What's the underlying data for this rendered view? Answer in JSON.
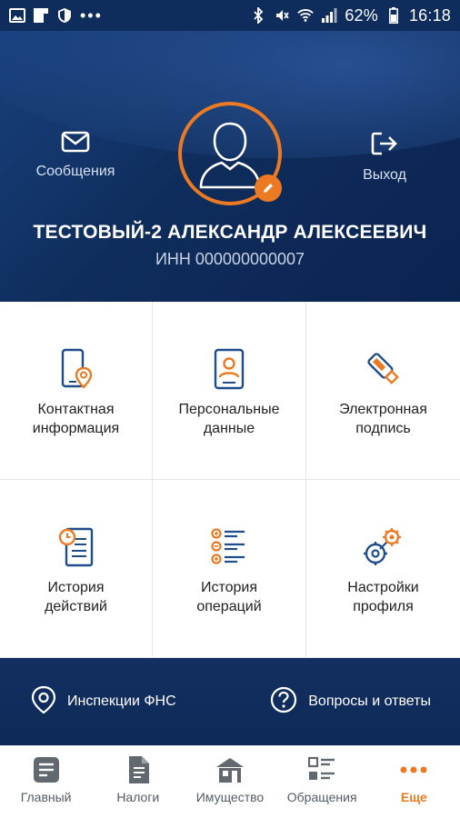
{
  "status_bar": {
    "battery": "62%",
    "time": "16:18",
    "overflow": "•••",
    "icons": [
      "image-icon",
      "flipboard-icon",
      "shield-icon",
      "bluetooth-icon",
      "mute-icon",
      "wifi-icon",
      "signal-icon"
    ]
  },
  "header": {
    "messages_label": "Сообщения",
    "logout_label": "Выход",
    "user_name": "ТЕСТОВЫЙ-2 АЛЕКСАНДР АЛЕКСЕЕВИЧ",
    "inn": "ИНН 000000000007"
  },
  "grid": [
    {
      "label": "Контактная\nинформация",
      "icon": "phone-location-icon"
    },
    {
      "label": "Персональные\nданные",
      "icon": "id-card-icon"
    },
    {
      "label": "Электронная\nподпись",
      "icon": "usb-key-icon"
    },
    {
      "label": "История\nдействий",
      "icon": "document-clock-icon"
    },
    {
      "label": "История\nопераций",
      "icon": "operations-list-icon"
    },
    {
      "label": "Настройки\nпрофиля",
      "icon": "settings-icon"
    }
  ],
  "band": {
    "inspections_label": "Инспекции ФНС",
    "faq_label": "Вопросы и ответы"
  },
  "nav": [
    {
      "label": "Главный",
      "icon": "home-doc-icon",
      "active": false
    },
    {
      "label": "Налоги",
      "icon": "taxes-doc-icon",
      "active": false
    },
    {
      "label": "Имущество",
      "icon": "property-icon",
      "active": false
    },
    {
      "label": "Обращения",
      "icon": "requests-icon",
      "active": false
    },
    {
      "label": "Еще",
      "icon": "more-icon",
      "active": true
    }
  ],
  "colors": {
    "accent": "#ec7a22",
    "primary": "#0f2d5c",
    "tile_icon_blue": "#1f4d8c"
  }
}
